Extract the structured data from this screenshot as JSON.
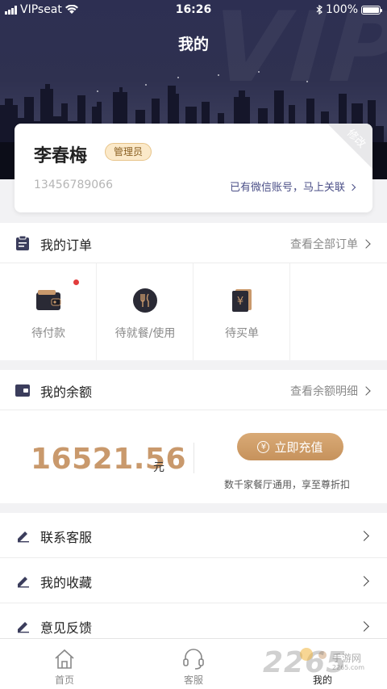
{
  "status_bar": {
    "carrier": "VIPseat",
    "time": "16:26",
    "battery": "100%"
  },
  "header": {
    "title": "我的",
    "background_watermark": "VIP"
  },
  "profile": {
    "name": "李春梅",
    "role_badge": "管理员",
    "phone": "13456789066",
    "wechat_link": "已有微信账号，马上关联",
    "edit_corner": "修改"
  },
  "orders": {
    "title": "我的订单",
    "more": "查看全部订单",
    "items": [
      {
        "label": "待付款",
        "icon": "wallet-icon",
        "has_dot": true
      },
      {
        "label": "待就餐/使用",
        "icon": "dining-icon",
        "has_dot": false
      },
      {
        "label": "待买单",
        "icon": "bill-icon",
        "has_dot": false
      }
    ]
  },
  "balance": {
    "title": "我的余额",
    "more": "查看余额明细",
    "amount": "16521.56",
    "unit": "元",
    "recharge_button": "立即充值",
    "recharge_note": "数千家餐厅通用，享至尊折扣"
  },
  "menu": [
    {
      "label": "联系客服",
      "icon": "edit-icon"
    },
    {
      "label": "我的收藏",
      "icon": "edit-icon"
    },
    {
      "label": "意见反馈",
      "icon": "edit-icon"
    }
  ],
  "tabbar": [
    {
      "label": "首页",
      "icon": "home-icon"
    },
    {
      "label": "客服",
      "icon": "headset-icon"
    },
    {
      "label": "我的",
      "icon": "user-icon"
    }
  ],
  "watermark": {
    "number": "2265",
    "text": "手游网",
    "url": "2265.com"
  },
  "colors": {
    "accent_gold": "#c9996c",
    "header_dark": "#2f3150",
    "link_blue": "#4b4f87",
    "dot_red": "#e23c3c"
  }
}
